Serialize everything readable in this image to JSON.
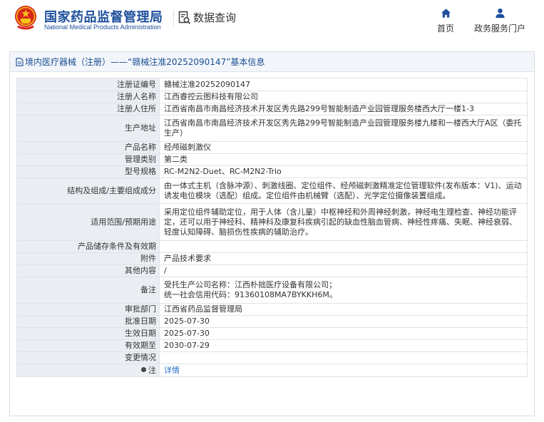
{
  "header": {
    "org_name_cn": "国家药品监督管理局",
    "org_name_en": "National Medical Products Administration",
    "query_label": "数据查询",
    "nav": [
      {
        "label": "首页",
        "icon": "home-icon"
      },
      {
        "label": "政务服务门户",
        "icon": "user-icon"
      }
    ]
  },
  "panel": {
    "title": "境内医疗器械（注册）——“赣械注准20252090147”基本信息",
    "rows": [
      {
        "label": "注册证编号",
        "value": "赣械注准20252090147"
      },
      {
        "label": "注册人名称",
        "value": "江西睿控云图科技有限公司"
      },
      {
        "label": "注册人住所",
        "value": "江西省南昌市南昌经济技术开发区秀先路299号智能制造产业园管理服务楼西大厅一楼1-3"
      },
      {
        "label": "生产地址",
        "value": "江西省南昌市南昌经济技术开发区秀先路299号智能制造产业园管理服务楼九楼和一楼西大厅A区（委托生产）"
      },
      {
        "label": "产品名称",
        "value": "经颅磁刺激仪"
      },
      {
        "label": "管理类别",
        "value": "第二类"
      },
      {
        "label": "型号规格",
        "value": "RC-M2N2-Duet、RC-M2N2-Trio"
      },
      {
        "label": "结构及组成/主要组成成分",
        "value": "由一体式主机（含脉冲源）、刺激线圈、定位组件、经颅磁刺激精准定位管理软件(发布版本：V1)、运动诱发电位模块（选配）组成。定位组件由机械臂（选配）、光学定位摄像装置组成。"
      },
      {
        "label": "适用范围/预期用途",
        "value": "采用定位组件辅助定位，用于人体（含儿童）中枢神经和外周神经刺激，神经电生理检查、神经功能评定，还可以用于神经科、精神科及康复科疾病引起的缺血性脑血管病、神经性疼痛、失眠、神经衰弱、轻度认知障碍、脑损伤性疾病的辅助治疗。"
      },
      {
        "label": "产品储存条件及有效期",
        "value": ""
      },
      {
        "label": "附件",
        "value": "产品技术要求"
      },
      {
        "label": "其他内容",
        "value": "/"
      },
      {
        "label": "备注",
        "value": "受托生产公司名称：江西朴拙医疗设备有限公司；",
        "value2": "统一社会信用代码：91360108MA7BYKKH6M。"
      },
      {
        "label": "审批部门",
        "value": "江西省药品监督管理局"
      },
      {
        "label": "批准日期",
        "value": "2025-07-30"
      },
      {
        "label": "生效日期",
        "value": "2025-07-30"
      },
      {
        "label": "有效期至",
        "value": "2030-07-29"
      },
      {
        "label": "变更情况",
        "value": ""
      },
      {
        "label": "注",
        "value": "详情"
      }
    ]
  }
}
